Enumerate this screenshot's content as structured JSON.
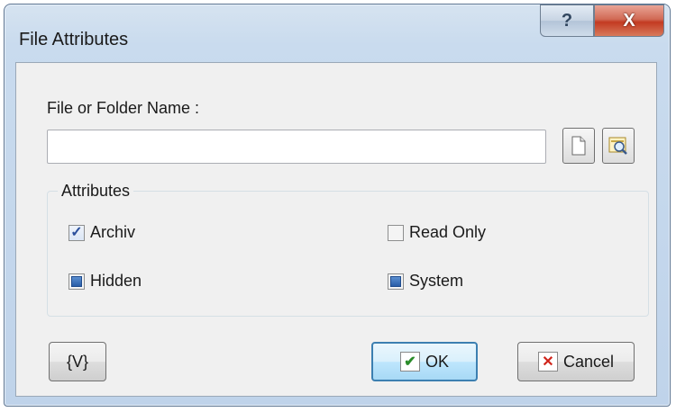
{
  "window": {
    "title": "File Attributes"
  },
  "titlebar": {
    "help_label": "?",
    "close_label": "X"
  },
  "file": {
    "label": "File or Folder Name :",
    "value": ""
  },
  "attributes": {
    "group_title": "Attributes",
    "archiv": {
      "label": "Archiv",
      "state": "checked"
    },
    "read_only": {
      "label": "Read Only",
      "state": "unchecked"
    },
    "hidden": {
      "label": "Hidden",
      "state": "indeterminate"
    },
    "system": {
      "label": "System",
      "state": "indeterminate"
    }
  },
  "buttons": {
    "variables": "{V}",
    "ok": "OK",
    "cancel": "Cancel"
  },
  "colors": {
    "ok_check": "#2a8c2a",
    "cancel_x": "#d0241b",
    "accent": "#3c7fb1"
  }
}
